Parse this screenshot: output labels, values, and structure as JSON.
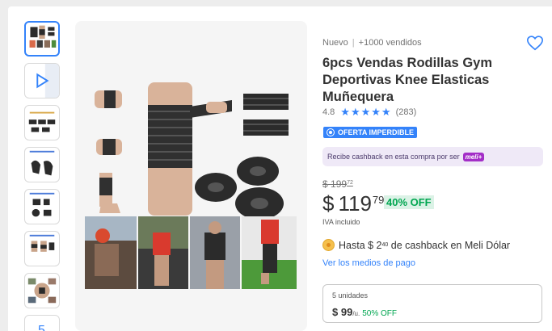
{
  "gallery": {
    "thumbnails": [
      {
        "name": "thumb-1",
        "icon": "product-thumbnail",
        "active": true
      },
      {
        "name": "thumb-2",
        "icon": "play-icon",
        "active": false
      },
      {
        "name": "thumb-3",
        "icon": "product-thumbnail",
        "active": false
      },
      {
        "name": "thumb-4",
        "icon": "product-thumbnail",
        "active": false
      },
      {
        "name": "thumb-5",
        "icon": "product-thumbnail",
        "active": false
      },
      {
        "name": "thumb-6",
        "icon": "product-thumbnail",
        "active": false
      },
      {
        "name": "thumb-7",
        "icon": "product-thumbnail",
        "active": false
      },
      {
        "name": "thumb-8",
        "label": "5",
        "active": false
      }
    ]
  },
  "product": {
    "condition": "Nuevo",
    "separator": "|",
    "sold": "+1000 vendidos",
    "title": "6pcs Vendas Rodillas Gym Deportivas Knee Elasticas Muñequera",
    "rating": "4.8",
    "stars": "★★★★★",
    "reviews": "(283)",
    "badge": "OFERTA IMPERDIBLE",
    "cashback_banner": "Recibe cashback en esta compra por ser",
    "meli_plus": "meli+",
    "old_price_symbol": "$",
    "old_price": "199",
    "old_price_cents": "72",
    "price_symbol": "$",
    "price": "119",
    "price_cents": "79",
    "discount": "40% OFF",
    "tax_note": "IVA incluido",
    "cashback_prefix": "Hasta $ 2",
    "cashback_cents": "40",
    "cashback_suffix": "de cashback en Meli Dólar",
    "payment_link": "Ver los medios de pago"
  },
  "bulk": {
    "units_label": "5 unidades",
    "price": "$ 99",
    "per": "/u.",
    "discount": "50% OFF"
  },
  "colors": {
    "accent": "#3483fa",
    "discount_green": "#00a650",
    "meli_plus_purple": "#a32ec7"
  }
}
